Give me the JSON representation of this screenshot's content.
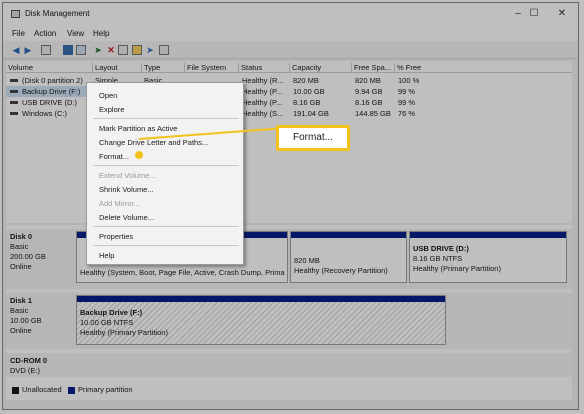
{
  "window": {
    "title": "Disk Management"
  },
  "menu": [
    "File",
    "Action",
    "View",
    "Help"
  ],
  "toolbar_icons": [
    "back-icon",
    "forward-icon",
    "up-icon",
    "properties-icon",
    "help-icon",
    "connect-icon",
    "delete-icon",
    "rescan-icon",
    "new-icon",
    "explore-icon"
  ],
  "columns": [
    "Volume",
    "Layout",
    "Type",
    "File System",
    "Status",
    "Capacity",
    "Free Spa...",
    "% Free"
  ],
  "volumes": [
    [
      "(Disk 0 partition 2)",
      "Simple",
      "Basic",
      "",
      "Healthy (R...",
      "820 MB",
      "820 MB",
      "100 %"
    ],
    [
      "Backup Drive (F:)",
      "",
      "",
      "",
      "Healthy (P...",
      "10.00 GB",
      "9.94 GB",
      "99 %"
    ],
    [
      "USB DRIVE (D:)",
      "",
      "",
      "",
      "Healthy (P...",
      "8.16 GB",
      "8.16 GB",
      "99 %"
    ],
    [
      "Windows (C:)",
      "",
      "",
      "",
      "Healthy (S...",
      "191.04 GB",
      "144.85 GB",
      "76 %"
    ]
  ],
  "disks": {
    "disk0": {
      "name": "Disk 0",
      "type": "Basic",
      "size": "200.00 GB",
      "state": "Online",
      "p1": "Healthy (System, Boot, Page File, Active, Crash Dump, Prima",
      "p2_size": "820 MB",
      "p2_status": "Healthy (Recovery Partition)",
      "p3_name": "USB DRIVE  (D:)",
      "p3_size": "8.16 GB NTFS",
      "p3_status": "Healthy (Primary Partition)"
    },
    "disk1": {
      "name": "Disk 1",
      "type": "Basic",
      "size": "10.00 GB",
      "state": "Online",
      "p1_name": "Backup Drive  (F:)",
      "p1_size": "10.00 GB NTFS",
      "p1_status": "Healthy (Primary Partition)"
    },
    "cdrom": {
      "name": "CD-ROM 0",
      "drive": "DVD (E:)"
    }
  },
  "legend": {
    "unallocated": "Unallocated",
    "primary": "Primary partition",
    "unallocated_color": "#1a1a1a",
    "primary_color": "#0a1f8a"
  },
  "context_menu": {
    "open": "Open",
    "explore": "Explore",
    "mark_active": "Mark Partition as Active",
    "change_letter": "Change Drive Letter and Paths...",
    "format": "Format...",
    "extend": "Extend Volume...",
    "shrink": "Shrink Volume...",
    "mirror": "Add Mirror...",
    "delete": "Delete Volume...",
    "properties": "Properties",
    "help": "Help"
  },
  "callout": {
    "label": "Format...",
    "color": "#f3c21a"
  }
}
